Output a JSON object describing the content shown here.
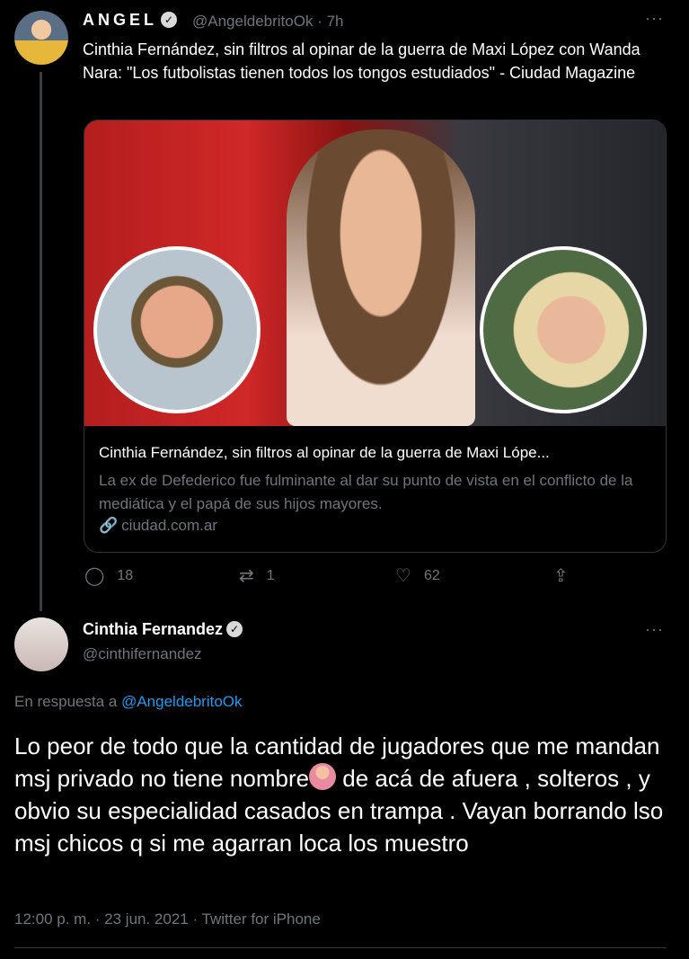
{
  "tweet1": {
    "name": "ANGEL",
    "verified_mark": "✓",
    "handle": "@AngeldebritoOk",
    "sep": "·",
    "time": "7h",
    "more": "···",
    "text": "Cinthia Fernández, sin filtros al opinar de la guerra de Maxi López con Wanda Nara: \"Los futbolistas tienen todos los tongos estudiados\" - Ciudad Magazine",
    "card": {
      "title": "Cinthia Fernández, sin filtros al opinar de la guerra de Maxi Lópe...",
      "description": "La ex de Defederico fue fulminante al dar su punto de vista en el conflicto de la mediática y el papá de sus hijos mayores.",
      "link_icon": "🔗",
      "domain": "ciudad.com.ar"
    },
    "actions": {
      "reply_icon": "◯",
      "reply_count": "18",
      "retweet_icon": "⇄",
      "retweet_count": "1",
      "like_icon": "♡",
      "like_count": "62",
      "share_icon": "⇪"
    }
  },
  "tweet2": {
    "name": "Cinthia Fernandez",
    "verified_mark": "✓",
    "handle": "@cinthifernandez",
    "more": "···",
    "reply_prefix": "En respuesta a ",
    "reply_mention": "@AngeldebritoOk",
    "text_part1": "Lo peor de todo que la cantidad de jugadores que me mandan msj privado no tiene nombre",
    "text_part2": " de acá de afuera , solteros , y obvio su especialidad casados en trampa . Vayan borrando lso msj chicos q si me agarran loca los muestro",
    "meta": "12:00 p. m. · 23 jun. 2021 · Twitter for iPhone"
  }
}
